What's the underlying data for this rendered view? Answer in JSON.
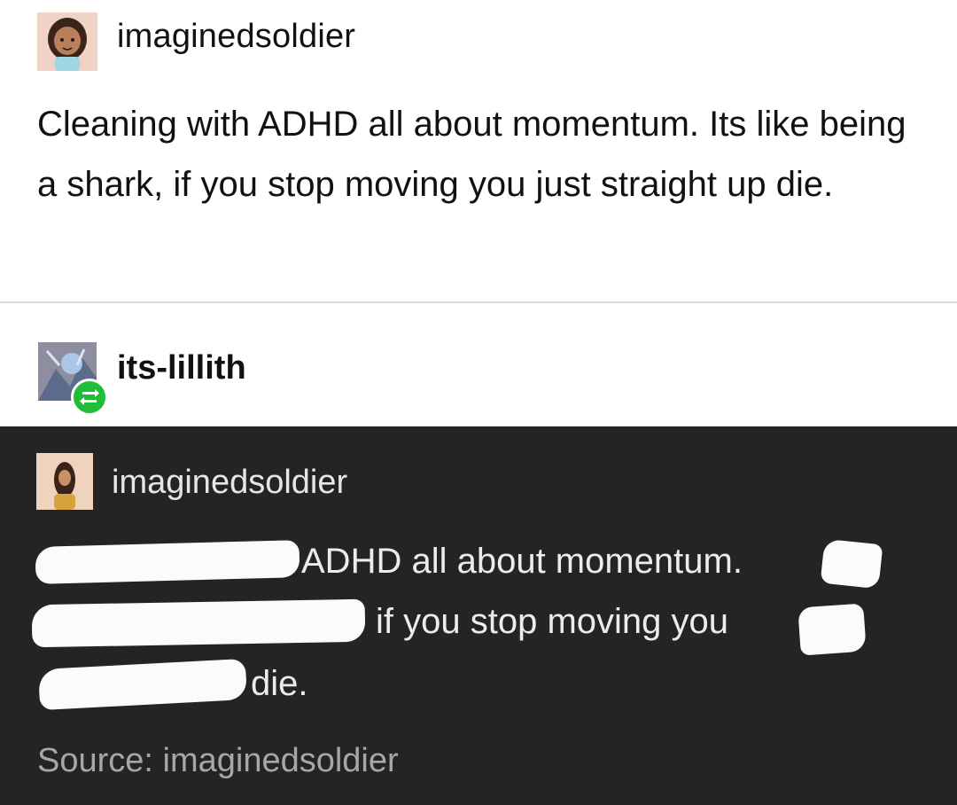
{
  "post": {
    "username": "imaginedsoldier",
    "body": "Cleaning with ADHD all about momentum. Its like being a shark, if you stop moving you just straight up die."
  },
  "reblog": {
    "username": "its-lillith",
    "badge_icon": "reblog-arrows-icon",
    "badge_color": "#1fbe37"
  },
  "embedded": {
    "username": "imaginedsoldier",
    "lines": [
      "ADHD all about momentum.",
      "if you stop moving you",
      "die."
    ],
    "source": "Source: imaginedsoldier",
    "background_color": "#242424"
  }
}
